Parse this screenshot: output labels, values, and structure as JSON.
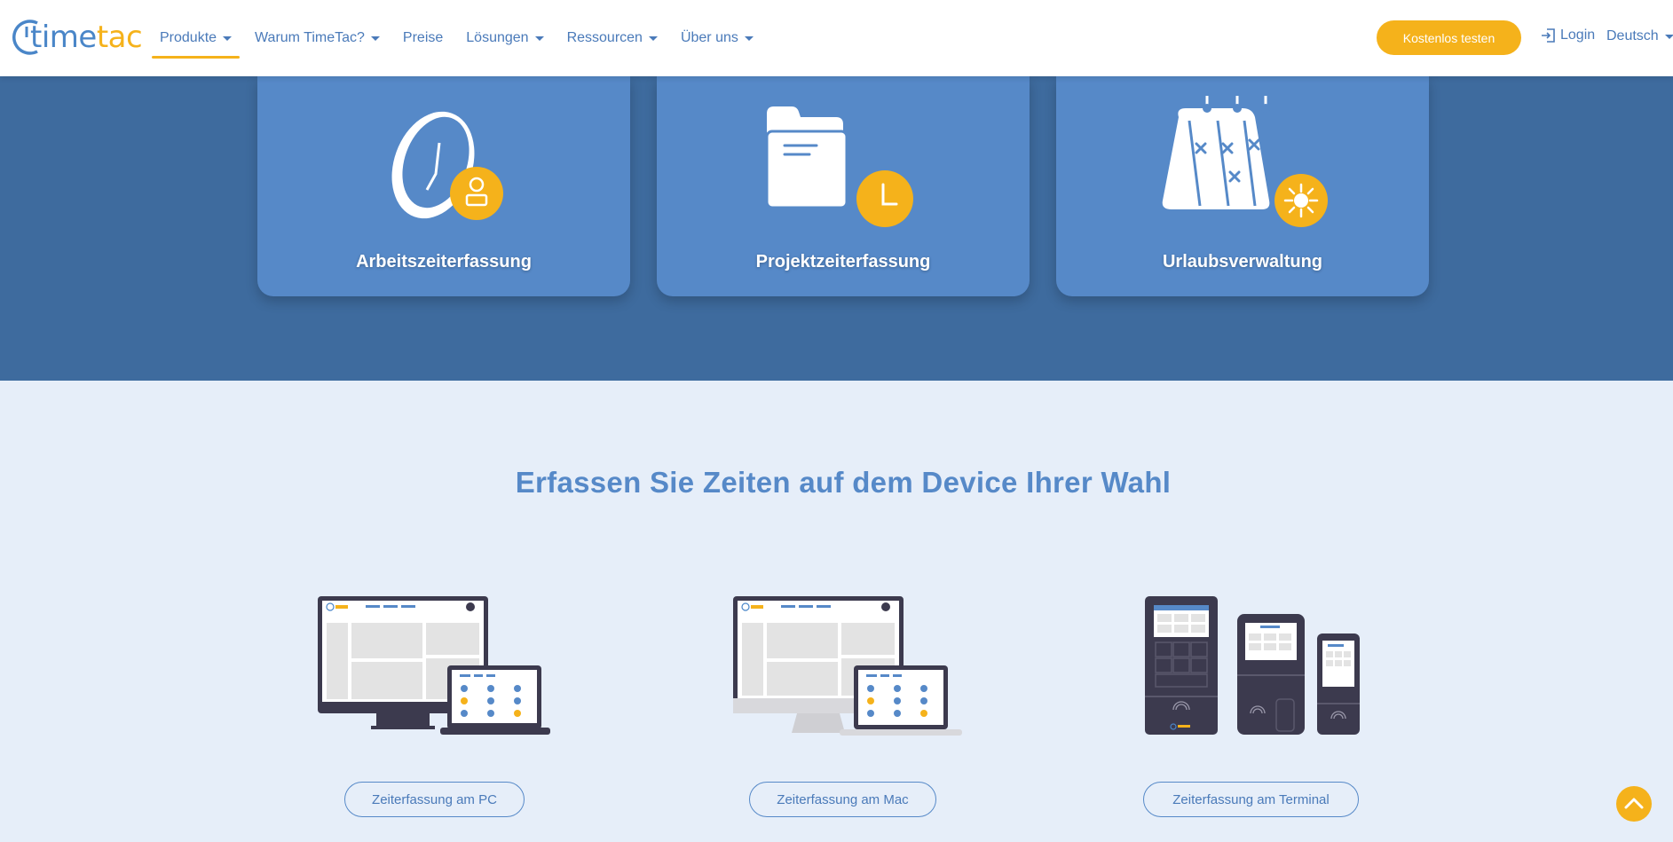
{
  "brand": {
    "logo_a": "time",
    "logo_b": "tac"
  },
  "nav": {
    "items": [
      {
        "label": "Produkte",
        "dropdown": true,
        "active": true
      },
      {
        "label": "Warum TimeTac?",
        "dropdown": true
      },
      {
        "label": "Preise",
        "dropdown": false
      },
      {
        "label": "Lösungen",
        "dropdown": true
      },
      {
        "label": "Ressourcen",
        "dropdown": true
      },
      {
        "label": "Über uns",
        "dropdown": true
      }
    ],
    "cta": "Kostenlos testen",
    "login": "Login",
    "language": "Deutsch"
  },
  "cards": [
    {
      "label": "Arbeitszeiterfassung",
      "icon": "clock-user-icon"
    },
    {
      "label": "Projektzeiterfassung",
      "icon": "folder-clock-icon"
    },
    {
      "label": "Urlaubsverwaltung",
      "icon": "calendar-sun-icon"
    }
  ],
  "section": {
    "headline": "Erfassen Sie Zeiten auf dem Device Ihrer Wahl",
    "devices": [
      {
        "label": "Zeiterfassung am PC"
      },
      {
        "label": "Zeiterfassung am Mac"
      },
      {
        "label": "Zeiterfassung am Terminal"
      }
    ]
  },
  "colors": {
    "accent": "#f5b21b",
    "primary": "#5689c8",
    "hero_bg": "#3e6b9e",
    "section_bg": "#e6eef9"
  }
}
